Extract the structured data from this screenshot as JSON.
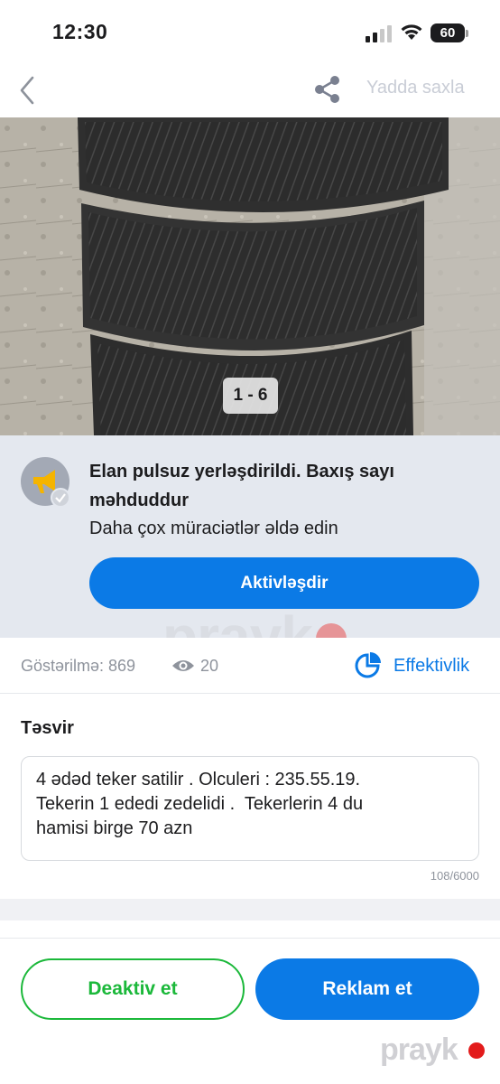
{
  "status_bar": {
    "time": "12:30",
    "battery": "60"
  },
  "nav": {
    "back_icon": "chevron-left-icon",
    "share_icon": "share-icon",
    "save_label": "Yadda saxla"
  },
  "photo": {
    "counter": "1 - 6"
  },
  "promo": {
    "icon": "megaphone-icon",
    "title": "Elan pulsuz yerləşdirildi. Baxış sayı məhduddur",
    "subtitle": "Daha çox müraciətlər əldə edin",
    "button_label": "Aktivləşdir"
  },
  "watermark": {
    "text": "prayk"
  },
  "stats": {
    "views_label": "Göstərilmə: 869",
    "eye_count": "20",
    "effectiveness_label": "Effektivlik"
  },
  "description": {
    "title": "Təsvir",
    "text": "4 ədəd teker satilir . Olculeri : 235.55.19.\nTekerin 1 ededi zedelidi .  Tekerlerin 4 du\nhamisi birge 70 azn",
    "counter": "108/6000"
  },
  "actions": {
    "deactivate_label": "Deaktiv et",
    "advertise_label": "Reklam et"
  },
  "colors": {
    "accent_blue": "#0b7ae6",
    "deactivate_green": "#1bb83a",
    "promo_bg": "#e4e8ef"
  }
}
